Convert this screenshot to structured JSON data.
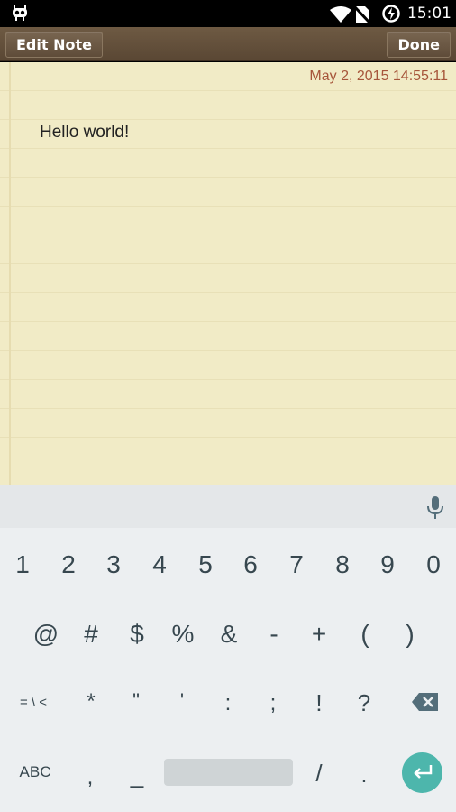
{
  "status_bar": {
    "time": "15:01",
    "icons": [
      "app-notification-icon",
      "wifi-icon",
      "no-sim-icon",
      "battery-charging-icon"
    ]
  },
  "toolbar": {
    "edit_label": "Edit Note",
    "done_label": "Done"
  },
  "note": {
    "timestamp": "May 2, 2015 14:55:11",
    "content": "Hello world!"
  },
  "keyboard": {
    "row1": [
      "1",
      "2",
      "3",
      "4",
      "5",
      "6",
      "7",
      "8",
      "9",
      "0"
    ],
    "row2": [
      "@",
      "#",
      "$",
      "%",
      "&",
      "-",
      "+",
      "(",
      ")"
    ],
    "row3": [
      "= \\ <",
      "*",
      "\"",
      "'",
      ":",
      ";",
      "!",
      "?"
    ],
    "row4": {
      "abc": "ABC",
      "comma": ",",
      "underscore": "_",
      "slash": "/",
      "period": "."
    }
  },
  "colors": {
    "toolbar": "#5f4c39",
    "paper": "#f1ebc6",
    "timestamp": "#a6553a",
    "enter_key": "#4db6ac",
    "keyboard_bg": "#eceff1"
  }
}
